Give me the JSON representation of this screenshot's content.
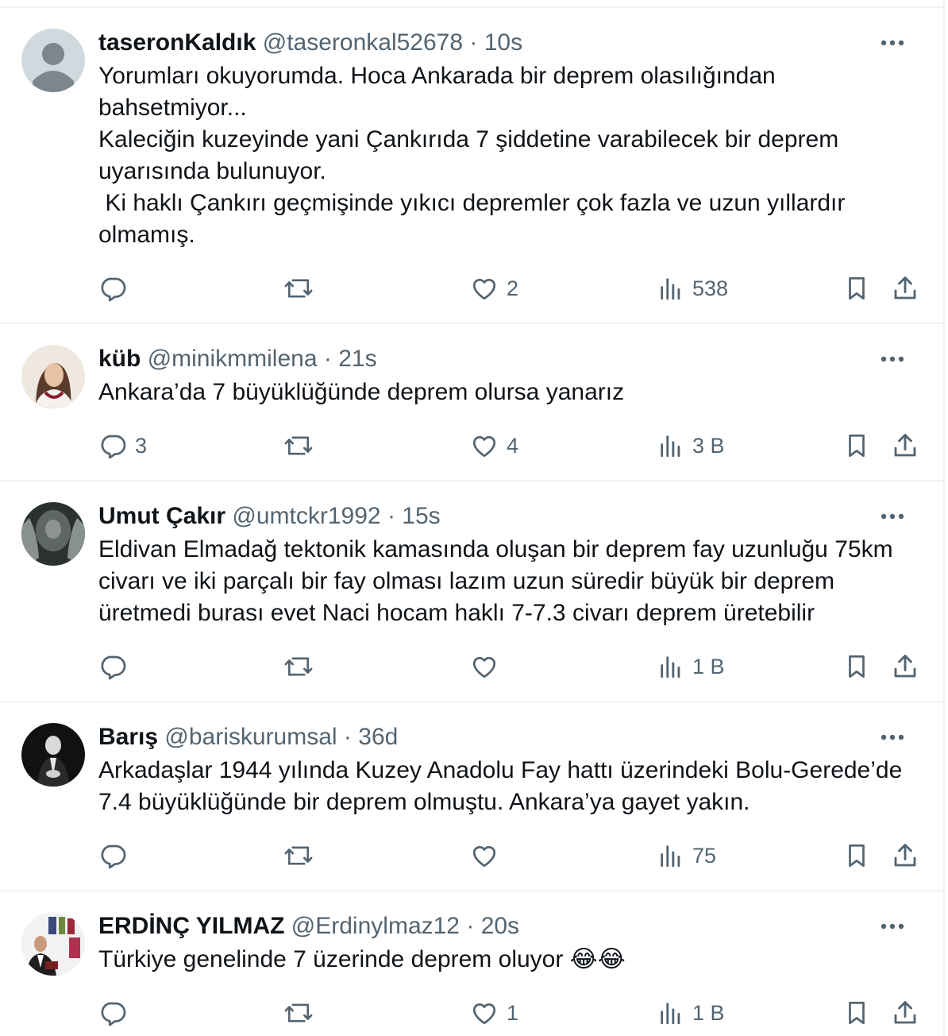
{
  "tweets": [
    {
      "name": "taseronKaldık",
      "handle": "@taseronkal52678",
      "separator": "·",
      "time": "10s",
      "text": "Yorumları okuyorumda. Hoca Ankarada bir deprem olasılığından\nbahsetmiyor...\nKaleciğin kuzeyinde yani Çankırıda 7 şiddetine varabilecek bir deprem\nuyarısında bulunuyor.\n Ki haklı Çankırı geçmişinde yıkıcı depremler çok fazla ve uzun yıllardır\nolmamış.",
      "replies": "",
      "likes": "2",
      "views": "538",
      "avatar": "default-avatar"
    },
    {
      "name": "küb",
      "handle": "@minikmmilena",
      "separator": "·",
      "time": "21s",
      "text": "Ankara’da 7 büyüklüğünde deprem olursa yanarız",
      "replies": "3",
      "likes": "4",
      "views": "3 B",
      "avatar": "woman-photo"
    },
    {
      "name": "Umut Çakır",
      "handle": "@umtckr1992",
      "separator": "·",
      "time": "15s",
      "text": "Eldivan Elmadağ tektonik kamasında oluşan bir deprem fay uzunluğu 75km\ncivarı ve iki parçalı bir fay olması lazım uzun süredir büyük bir deprem\nüretmedi burası evet Naci hocam haklı 7-7.3 civarı deprem üretebilir",
      "replies": "",
      "likes": "",
      "views": "1 B",
      "avatar": "statue-photo"
    },
    {
      "name": "Barış",
      "handle": "@bariskurumsal",
      "separator": "·",
      "time": "36d",
      "text": "Arkadaşlar 1944 yılında Kuzey Anadolu Fay hattı üzerindeki Bolu-Gerede’de\n7.4 büyüklüğünde bir deprem olmuştu. Ankara’ya gayet yakın.",
      "replies": "",
      "likes": "",
      "views": "75",
      "avatar": "dark-portrait-photo"
    },
    {
      "name": "ERDİNÇ YILMAZ",
      "handle": "@Erdinylmaz12",
      "separator": "·",
      "time": "20s",
      "text": "Türkiye genelinde 7 üzerinde deprem oluyor 😂😂",
      "replies": "",
      "likes": "1",
      "views": "1 B",
      "avatar": "man-photo"
    }
  ],
  "colors": {
    "text": "#0f1419",
    "secondary": "#536471",
    "border": "#eff3f4"
  },
  "icons": [
    "more-icon",
    "reply-icon",
    "retweet-icon",
    "like-icon",
    "views-icon",
    "bookmark-icon",
    "share-icon"
  ]
}
